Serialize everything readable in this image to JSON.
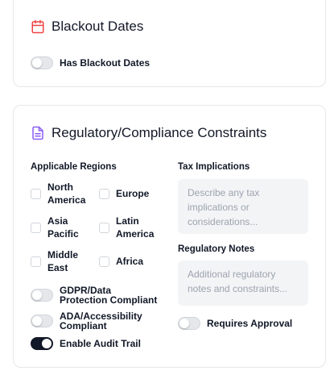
{
  "blackout": {
    "title": "Blackout Dates",
    "icon": "calendar-icon",
    "has_blackout_label": "Has Blackout Dates",
    "has_blackout_on": false
  },
  "regulatory": {
    "title": "Regulatory/Compliance Constraints",
    "icon": "document-icon",
    "regions_label": "Applicable Regions",
    "regions": [
      {
        "l1": "North",
        "l2": "America",
        "checked": false
      },
      {
        "l1": "Europe",
        "l2": "",
        "checked": false
      },
      {
        "l1": "Asia",
        "l2": "Pacific",
        "checked": false
      },
      {
        "l1": "Latin",
        "l2": "America",
        "checked": false
      },
      {
        "l1": "Middle",
        "l2": "East",
        "checked": false
      },
      {
        "l1": "Africa",
        "l2": "",
        "checked": false
      }
    ],
    "tax_label": "Tax Implications",
    "tax_placeholder_1": "Describe any tax",
    "tax_placeholder_2": "implications or",
    "tax_placeholder_3": "considerations...",
    "notes_label": "Regulatory Notes",
    "notes_placeholder_1": "Additional regulatory",
    "notes_placeholder_2": "notes and constraints...",
    "gdpr_1": "GDPR/Data",
    "gdpr_2": "Protection Compliant",
    "ada_1": "ADA/Accessibility",
    "ada_2": "Compliant",
    "audit_label": "Enable Audit Trail",
    "approval_label": "Requires Approval",
    "gdpr_on": false,
    "ada_on": false,
    "audit_on": true,
    "approval_on": false
  },
  "colors": {
    "calendar_icon": "#ef4444",
    "document_icon": "#8b5cf6",
    "toggle_on": "#111827"
  }
}
